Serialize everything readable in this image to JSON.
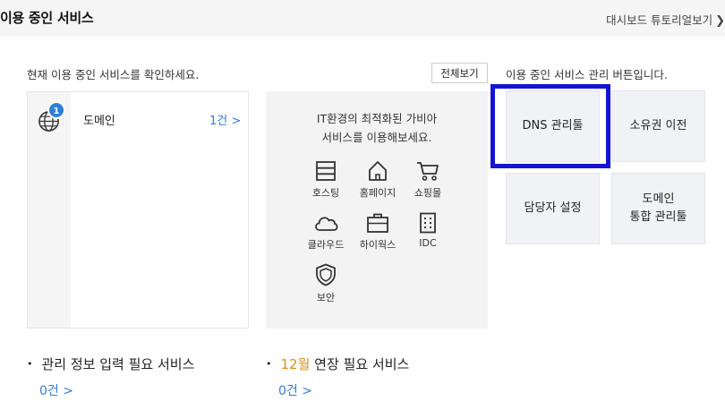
{
  "header": {
    "title": "이용 중인 서비스",
    "tutorial_link": "대시보드 튜토리얼보기"
  },
  "services": {
    "description": "현재 이용 중인 서비스를 확인하세요.",
    "view_all": "전체보기",
    "items": [
      {
        "name": "도메인",
        "count": "1건 >",
        "badge": "1",
        "icon": "globe-icon"
      }
    ]
  },
  "promo": {
    "text_line1": "IT환경의 최적화된 가비아",
    "text_line2": "서비스를 이용해보세요.",
    "items": [
      {
        "label": "호스팅",
        "icon": "server-icon"
      },
      {
        "label": "홈페이지",
        "icon": "home-icon"
      },
      {
        "label": "쇼핑몰",
        "icon": "cart-icon"
      },
      {
        "label": "클라우드",
        "icon": "cloud-icon"
      },
      {
        "label": "하이웍스",
        "icon": "briefcase-icon"
      },
      {
        "label": "IDC",
        "icon": "building-icon"
      },
      {
        "label": "보안",
        "icon": "shield-icon"
      }
    ]
  },
  "management": {
    "description": "이용 중인 서비스 관리 버튼입니다.",
    "buttons": {
      "dns": "DNS 관리툴",
      "transfer": "소유권 이전",
      "contact": "담당자 설정",
      "integrated_line1": "도메인",
      "integrated_line2": "통합 관리툴"
    }
  },
  "bottom": {
    "info_required": {
      "title": "관리 정보 입력 필요 서비스",
      "count": "0건 >"
    },
    "renewal": {
      "month": "12월",
      "title_rest": " 연장 필요 서비스",
      "count": "0건 >"
    }
  },
  "colors": {
    "accent_blue": "#2f7fd8",
    "highlight_border": "#1414d6",
    "month_orange": "#d99013"
  }
}
